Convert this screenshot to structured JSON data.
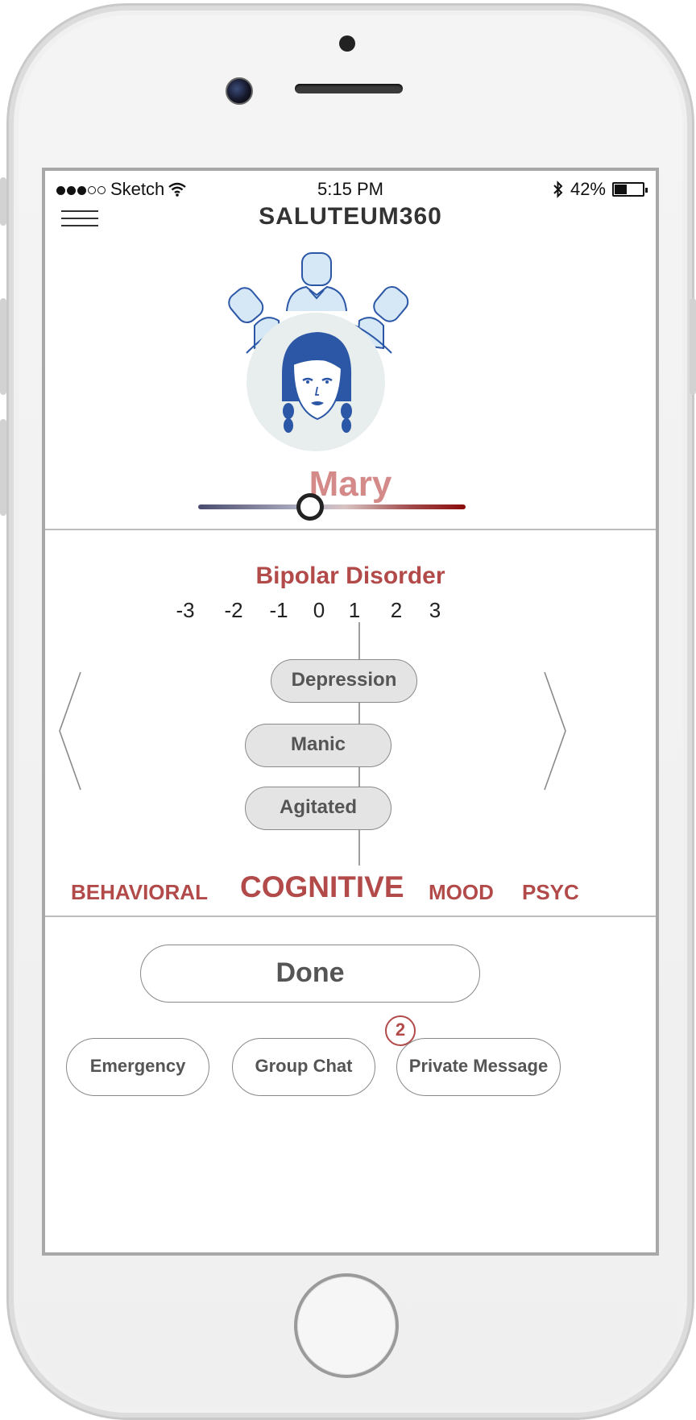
{
  "status_bar": {
    "carrier": "Sketch",
    "time": "5:15 PM",
    "battery": "42%",
    "battery_level": 0.42,
    "signal_bars_filled": 3,
    "signal_bars_total": 5
  },
  "header": {
    "title": "SALUTEUM360",
    "menu_icon": "hamburger-icon"
  },
  "profile": {
    "name": "Mary",
    "avatar_icon": "woman-avatar-icon",
    "network_icon": "care-team-network-icon",
    "mood_slider_value": 0.42,
    "slider_colors": {
      "low": "#4a4a6e",
      "high": "#8b0b0b"
    }
  },
  "assessment": {
    "title": "Bipolar Disorder",
    "scale": [
      "-3",
      "-2",
      "-1",
      "0",
      "1",
      "2",
      "3"
    ],
    "items": [
      {
        "label": "Depression",
        "value": 0
      },
      {
        "label": "Manic",
        "value": -1
      },
      {
        "label": "Agitated",
        "value": -1
      }
    ],
    "prev_icon": "chevron-left-icon",
    "next_icon": "chevron-right-icon"
  },
  "categories": {
    "tabs": [
      "BEHAVIORAL",
      "COGNITIVE",
      "MOOD",
      "PSYC"
    ],
    "active": "COGNITIVE"
  },
  "actions": {
    "done_label": "Done",
    "emergency_label": "Emergency",
    "group_chat_label": "Group Chat",
    "group_chat_badge": "2",
    "private_message_label": "Private Message"
  },
  "colors": {
    "accent": "#b24a4a",
    "name_color": "#d58a8a",
    "avatar_blue": "#2b57a6",
    "avatar_bg": "#e8eeee"
  }
}
